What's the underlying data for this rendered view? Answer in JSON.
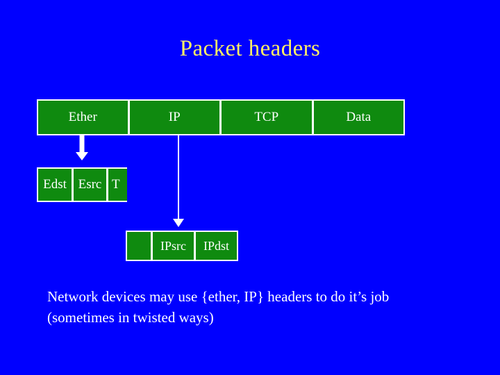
{
  "slide": {
    "title": "Packet headers",
    "background_color": "#0000ff",
    "title_color": "#ffef66",
    "box_fill_color": "#0f8a0f",
    "box_border_color": "#ffffff",
    "box_text_color": "#ffffff",
    "body_text_color": "#ffffff"
  },
  "frame_row": {
    "name": "packet-frame-row",
    "cells": [
      {
        "label": "Ether"
      },
      {
        "label": "IP"
      },
      {
        "label": "TCP"
      },
      {
        "label": "Data"
      }
    ]
  },
  "ether_row": {
    "name": "ethernet-header-row",
    "cells": [
      {
        "label": "Edst"
      },
      {
        "label": "Esrc"
      },
      {
        "label": "T"
      }
    ]
  },
  "ip_row": {
    "name": "ip-header-row",
    "cells": [
      {
        "label": ""
      },
      {
        "label": "IPsrc"
      },
      {
        "label": "IPdst"
      }
    ]
  },
  "arrows": [
    {
      "name": "ether-expand-arrow",
      "direction": "down"
    },
    {
      "name": "ip-expand-arrow",
      "direction": "down"
    }
  ],
  "body": {
    "line1": "Network devices may use {ether, IP} headers to do it’s job",
    "line2": "(sometimes in twisted ways)"
  }
}
